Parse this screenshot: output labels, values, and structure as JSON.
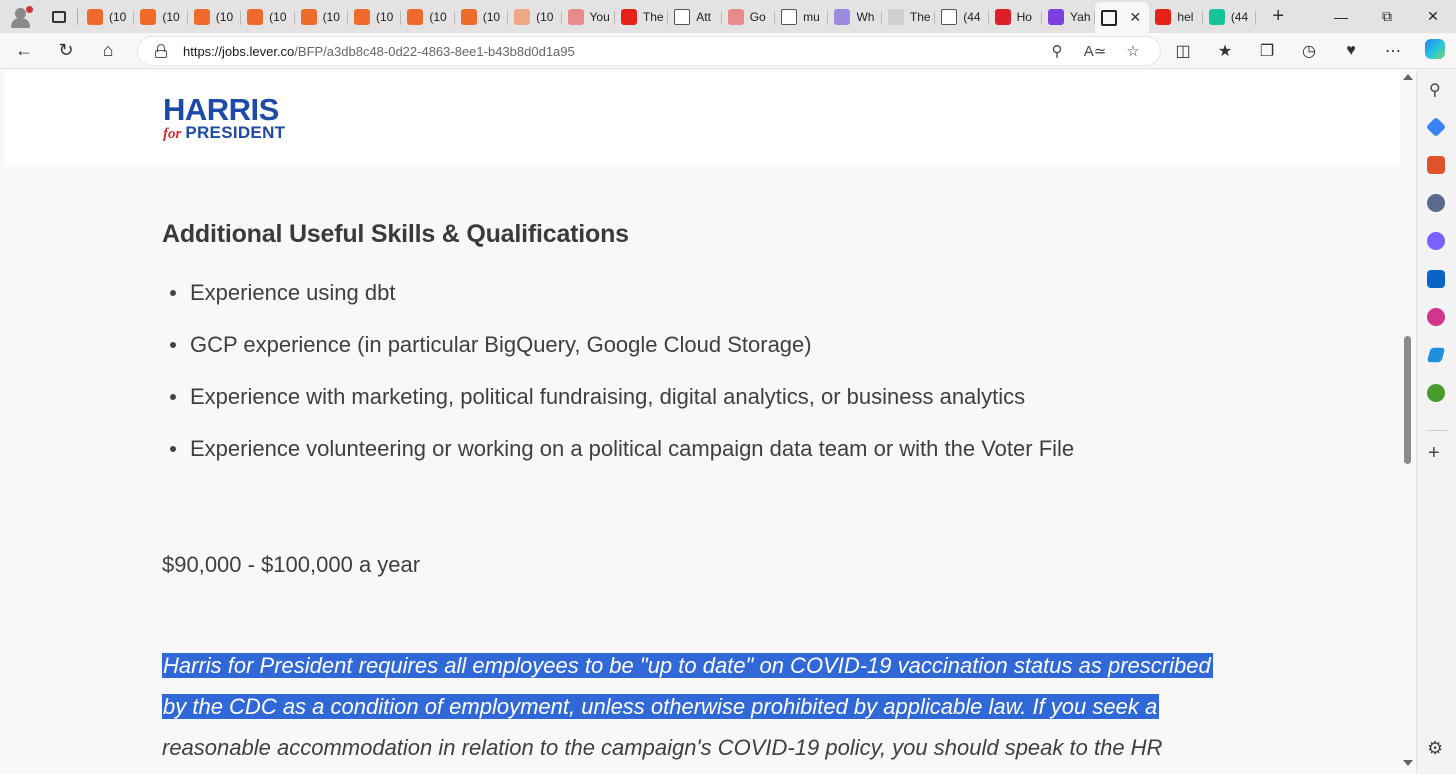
{
  "browser": {
    "tabs": [
      {
        "label": "(10",
        "icon": "bookmark-orange-icon",
        "color": "#f06a2a"
      },
      {
        "label": "(10",
        "icon": "bookmark-orange-icon",
        "color": "#f06a2a"
      },
      {
        "label": "(10",
        "icon": "bookmark-orange-icon",
        "color": "#f06a2a"
      },
      {
        "label": "(10",
        "icon": "bookmark-orange-icon",
        "color": "#f06a2a"
      },
      {
        "label": "(10",
        "icon": "bookmark-orange-icon",
        "color": "#f06a2a"
      },
      {
        "label": "(10",
        "icon": "bookmark-orange-icon",
        "color": "#f06a2a"
      },
      {
        "label": "(10",
        "icon": "bookmark-orange-icon",
        "color": "#f06a2a"
      },
      {
        "label": "(10",
        "icon": "bookmark-orange-icon",
        "color": "#f06a2a"
      },
      {
        "label": "(10",
        "icon": "bookmark-faded-icon",
        "color": "#f0a884"
      },
      {
        "label": "You",
        "icon": "youtube-faded-icon",
        "color": "#e88a8a"
      },
      {
        "label": "The",
        "icon": "youtube-icon",
        "color": "#e62117"
      },
      {
        "label": "Att",
        "icon": "document-icon",
        "color": "#ffffff"
      },
      {
        "label": "Go",
        "icon": "youtube-faded-icon",
        "color": "#e88a8a"
      },
      {
        "label": "mu",
        "icon": "document-icon",
        "color": "#ffffff"
      },
      {
        "label": "Wh",
        "icon": "globe-purple-icon",
        "color": "#9b8ae0"
      },
      {
        "label": "The",
        "icon": "dots-icon",
        "color": "#cfcfcf"
      },
      {
        "label": "(44",
        "icon": "document-icon",
        "color": "#ffffff"
      },
      {
        "label": "Ho",
        "icon": "pin-red-icon",
        "color": "#e01e2a"
      },
      {
        "label": "Yah",
        "icon": "yahoo-icon",
        "color": "#7e3fe0"
      },
      {
        "label": "",
        "icon": "edit-icon",
        "color": "#222222",
        "active": true
      },
      {
        "label": "hel",
        "icon": "youtube-icon",
        "color": "#e62117"
      },
      {
        "label": "(44",
        "icon": "grammarly-icon",
        "color": "#15c39a"
      }
    ],
    "url_host": "https://jobs.lever.co",
    "url_path": "/BFP/a3db8c48-0d22-4863-8ee1-b43b8d0d1a95"
  },
  "logo": {
    "line1": "HARRIS",
    "for": "for",
    "line2": "PRESIDENT"
  },
  "section": {
    "heading": "Additional Useful Skills & Qualifications",
    "items": [
      "Experience using dbt",
      "GCP experience (in particular BigQuery, Google Cloud Storage)",
      "Experience with marketing, political fundraising, digital analytics, or business analytics",
      "Experience volunteering or working on a political campaign data team or with the Voter File"
    ]
  },
  "salary": "$90,000 - $100,000 a year",
  "policy": {
    "line1": "Harris for President requires all employees to be \"up to date\" on COVID-19 vaccination status as prescribed",
    "line2": "by the CDC as a condition of employment, unless otherwise prohibited by applicable law. If you seek a",
    "line3": "reasonable accommodation in relation to the campaign's COVID-19 policy, you should speak to the HR"
  },
  "colors": {
    "brand_blue": "#1f4aa8",
    "brand_red": "#d42d2d",
    "selection": "#3168d8"
  }
}
